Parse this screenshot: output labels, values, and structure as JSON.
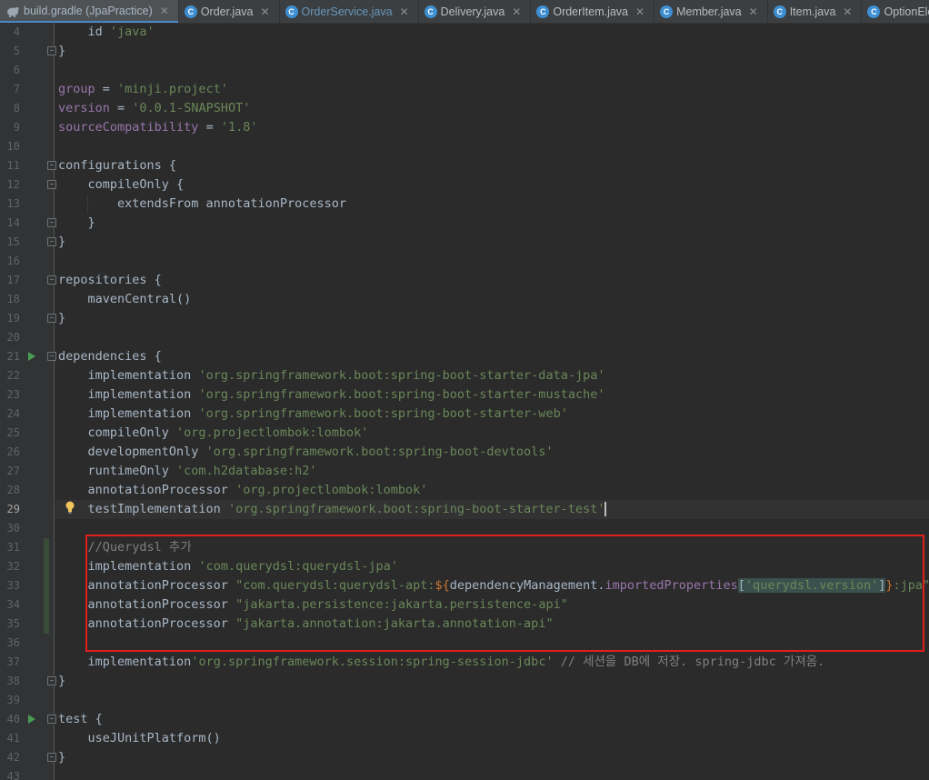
{
  "tabs": [
    {
      "label": "build.gradle (JpaPractice)",
      "icon": "gradle-icon",
      "active": true
    },
    {
      "label": "Order.java",
      "icon": "class-icon"
    },
    {
      "label": "OrderService.java",
      "icon": "class-icon",
      "blue": true
    },
    {
      "label": "Delivery.java",
      "icon": "class-icon"
    },
    {
      "label": "OrderItem.java",
      "icon": "class-icon"
    },
    {
      "label": "Member.java",
      "icon": "class-icon"
    },
    {
      "label": "Item.java",
      "icon": "class-icon"
    },
    {
      "label": "OptionElement.java",
      "icon": "class-icon"
    }
  ],
  "tab_close_glyph": "✕",
  "class_icon_letter": "C",
  "editor": {
    "current_line": "29",
    "lines": [
      {
        "n": "4",
        "parts": [
          [
            "",
            "    id "
          ],
          [
            "str",
            "'java'"
          ]
        ]
      },
      {
        "n": "5",
        "parts": [
          [
            "",
            "}"
          ]
        ]
      },
      {
        "n": "6",
        "parts": []
      },
      {
        "n": "7",
        "parts": [
          [
            "purple",
            "group"
          ],
          [
            "",
            " = "
          ],
          [
            "str",
            "'minji.project'"
          ]
        ]
      },
      {
        "n": "8",
        "parts": [
          [
            "purple",
            "version"
          ],
          [
            "",
            " = "
          ],
          [
            "str",
            "'0.0.1-SNAPSHOT'"
          ]
        ]
      },
      {
        "n": "9",
        "parts": [
          [
            "purple",
            "sourceCompatibility"
          ],
          [
            "",
            " = "
          ],
          [
            "str",
            "'1.8'"
          ]
        ]
      },
      {
        "n": "10",
        "parts": []
      },
      {
        "n": "11",
        "parts": [
          [
            "",
            "configurations {"
          ]
        ]
      },
      {
        "n": "12",
        "parts": [
          [
            "",
            "    compileOnly {"
          ]
        ]
      },
      {
        "n": "13",
        "parts": [
          [
            "",
            "        extendsFrom annotationProcessor"
          ]
        ]
      },
      {
        "n": "14",
        "parts": [
          [
            "",
            "    }"
          ]
        ]
      },
      {
        "n": "15",
        "parts": [
          [
            "",
            "}"
          ]
        ]
      },
      {
        "n": "16",
        "parts": []
      },
      {
        "n": "17",
        "parts": [
          [
            "",
            "repositories {"
          ]
        ]
      },
      {
        "n": "18",
        "parts": [
          [
            "",
            "    mavenCentral()"
          ]
        ]
      },
      {
        "n": "19",
        "parts": [
          [
            "",
            "}"
          ]
        ]
      },
      {
        "n": "20",
        "parts": []
      },
      {
        "n": "21",
        "parts": [
          [
            "",
            "dependencies {"
          ]
        ]
      },
      {
        "n": "22",
        "parts": [
          [
            "",
            "    implementation "
          ],
          [
            "str",
            "'org.springframework.boot:spring-boot-starter-data-jpa'"
          ]
        ]
      },
      {
        "n": "23",
        "parts": [
          [
            "",
            "    implementation "
          ],
          [
            "str",
            "'org.springframework.boot:spring-boot-starter-mustache'"
          ]
        ]
      },
      {
        "n": "24",
        "parts": [
          [
            "",
            "    implementation "
          ],
          [
            "str",
            "'org.springframework.boot:spring-boot-starter-web'"
          ]
        ]
      },
      {
        "n": "25",
        "parts": [
          [
            "",
            "    compileOnly "
          ],
          [
            "str",
            "'org.projectlombok:lombok'"
          ]
        ]
      },
      {
        "n": "26",
        "parts": [
          [
            "",
            "    developmentOnly "
          ],
          [
            "str",
            "'org.springframework.boot:spring-boot-devtools'"
          ]
        ]
      },
      {
        "n": "27",
        "parts": [
          [
            "",
            "    runtimeOnly "
          ],
          [
            "str",
            "'com.h2database:h2'"
          ]
        ]
      },
      {
        "n": "28",
        "parts": [
          [
            "",
            "    annotationProcessor "
          ],
          [
            "str",
            "'org.projectlombok:lombok'"
          ]
        ]
      },
      {
        "n": "29",
        "parts": [
          [
            "",
            "    testImplementation "
          ],
          [
            "str",
            "'org.springframework.boot:spring-boot-starter-test'"
          ]
        ]
      },
      {
        "n": "30",
        "parts": []
      },
      {
        "n": "31",
        "parts": [
          [
            "comment",
            "    //Querydsl 추가"
          ]
        ]
      },
      {
        "n": "32",
        "parts": [
          [
            "",
            "    implementation "
          ],
          [
            "str",
            "'com.querydsl:querydsl-jpa'"
          ]
        ]
      },
      {
        "n": "33",
        "parts": [
          [
            "",
            "    annotationProcessor "
          ],
          [
            "str",
            "\"com.querydsl:querydsl-apt:"
          ],
          [
            "kw",
            "${"
          ],
          [
            "",
            "dependencyManagement."
          ],
          [
            "purple",
            "importedProperties"
          ],
          [
            "match",
            "["
          ],
          [
            "strmatch",
            "'querydsl.version'"
          ],
          [
            "match",
            "]"
          ],
          [
            "kw",
            "}"
          ],
          [
            "str",
            ":jpa\""
          ]
        ]
      },
      {
        "n": "34",
        "parts": [
          [
            "",
            "    annotationProcessor "
          ],
          [
            "str",
            "\"jakarta.persistence:jakarta.persistence-api\""
          ]
        ]
      },
      {
        "n": "35",
        "parts": [
          [
            "",
            "    annotationProcessor "
          ],
          [
            "str",
            "\"jakarta.annotation:jakarta.annotation-api\""
          ]
        ]
      },
      {
        "n": "36",
        "parts": []
      },
      {
        "n": "37",
        "parts": [
          [
            "",
            "    implementation"
          ],
          [
            "str",
            "'org.springframework.session:spring-session-jdbc'"
          ],
          [
            "comment",
            " // 세션을 DB에 저장. spring-jdbc 가져옴."
          ]
        ]
      },
      {
        "n": "38",
        "parts": [
          [
            "",
            "}"
          ]
        ]
      },
      {
        "n": "39",
        "parts": []
      },
      {
        "n": "40",
        "parts": [
          [
            "",
            "test {"
          ]
        ]
      },
      {
        "n": "41",
        "parts": [
          [
            "",
            "    useJUnitPlatform()"
          ]
        ]
      },
      {
        "n": "42",
        "parts": [
          [
            "",
            "}"
          ]
        ]
      },
      {
        "n": "43",
        "parts": []
      }
    ]
  },
  "colors": {
    "background": "#2b2b2b",
    "string": "#6a8759",
    "keyword": "#cc7832",
    "property": "#9876aa",
    "comment": "#808080",
    "highlight_box": "#e0201a"
  },
  "icons": {
    "fold_open": "fold-icon",
    "run": "run-gutter-icon",
    "bulb": "intention-bulb-icon"
  }
}
